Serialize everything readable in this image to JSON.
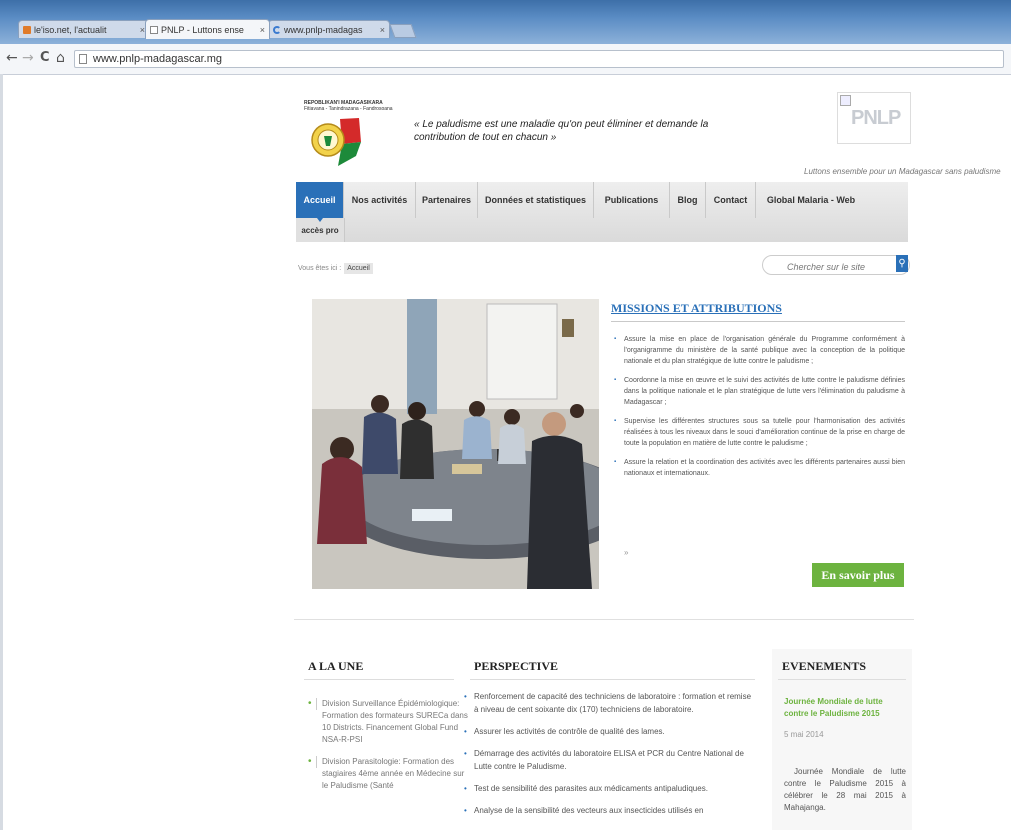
{
  "browser": {
    "tabs": [
      {
        "label": "le'iso.net, l'actualit"
      },
      {
        "label": "PNLP - Luttons ense"
      },
      {
        "label": "www.pnlp-madagas"
      }
    ],
    "url": "www.pnlp-madagascar.mg",
    "nav": {
      "back": "←",
      "forward": "→",
      "reload": "C",
      "home": "⌂"
    }
  },
  "header": {
    "republic": "REPOBLIKAN'I MADAGASIKARA",
    "motto": "Fitiavana - Tanindrazana - Fandrosoana",
    "slogan": "« Le paludisme est une maladie qu'on peut éliminer et demande la contribution de tout en chacun »",
    "logo_text": "PNLP",
    "tagline": "Luttons ensemble pour un Madagascar sans paludisme"
  },
  "nav": {
    "items": [
      {
        "label": "Accueil"
      },
      {
        "label": "Nos activités"
      },
      {
        "label": "Partenaires"
      },
      {
        "label": "Données et statistiques"
      },
      {
        "label": "Publications"
      },
      {
        "label": "Blog"
      },
      {
        "label": "Contact"
      },
      {
        "label": "Global Malaria - Web"
      }
    ],
    "sub": "accès pro"
  },
  "breadcrumb": {
    "prefix": "Vous êtes ici :",
    "current": "Accueil"
  },
  "search": {
    "placeholder": "Chercher sur le site",
    "icon": "search-icon"
  },
  "missions": {
    "title": "MISSIONS ET ATTRIBUTIONS",
    "items": [
      "Assure la mise en place de l'organisation générale du Programme conformément à l'organigramme du ministère de la santé publique avec la conception de la politique nationale et du plan stratégique de lutte contre le paludisme ;",
      "Coordonne la mise en œuvre et le suivi des activités de lutte contre le paludisme définies dans la politique nationale et le plan stratégique de lutte vers l'élimination du paludisme à Madagascar ;",
      "Supervise les différentes structures sous sa tutelle pour l'harmonisation des activités réalisées à tous les niveaux dans le souci d'amélioration continue de la prise en charge de toute la population en matière de lutte contre le paludisme ;",
      "Assure la relation et la coordination des activités avec les différents partenaires aussi bien nationaux et internationaux."
    ],
    "tail": "»",
    "more": "En savoir plus"
  },
  "a_la_une": {
    "title": "A LA UNE",
    "items": [
      "Division Surveillance Épidémiologique: Formation des formateurs SURECa dans 10 Districts. Financement Global Fund NSA-R-PSI",
      "Division Parasitologie: Formation des stagiaires 4ème année en Médecine sur le Paludisme (Santé"
    ]
  },
  "perspective": {
    "title": "PERSPECTIVE",
    "items": [
      "Renforcement de capacité des techniciens de laboratoire : formation et remise à niveau de cent soixante dix (170) techniciens de laboratoire.",
      "Assurer les activités de contrôle de qualité des lames.",
      "Démarrage des activités du laboratoire ELISA et PCR du Centre National de Lutte contre le Paludisme.",
      "Test de sensibilité des parasites aux médicaments antipaludiques.",
      "Analyse de la sensibilité des vecteurs aux insecticides utilisés en"
    ]
  },
  "evenements": {
    "title": "EVENEMENTS",
    "event_title": "Journée Mondiale de lutte contre le Paludisme 2015",
    "date": "5 mai 2014",
    "text": "Journée Mondiale de lutte contre le Paludisme 2015 à célébrer le 28 mai 2015 à Mahajanga."
  },
  "colors": {
    "brand_blue": "#2a70b8",
    "green": "#6db33f"
  }
}
